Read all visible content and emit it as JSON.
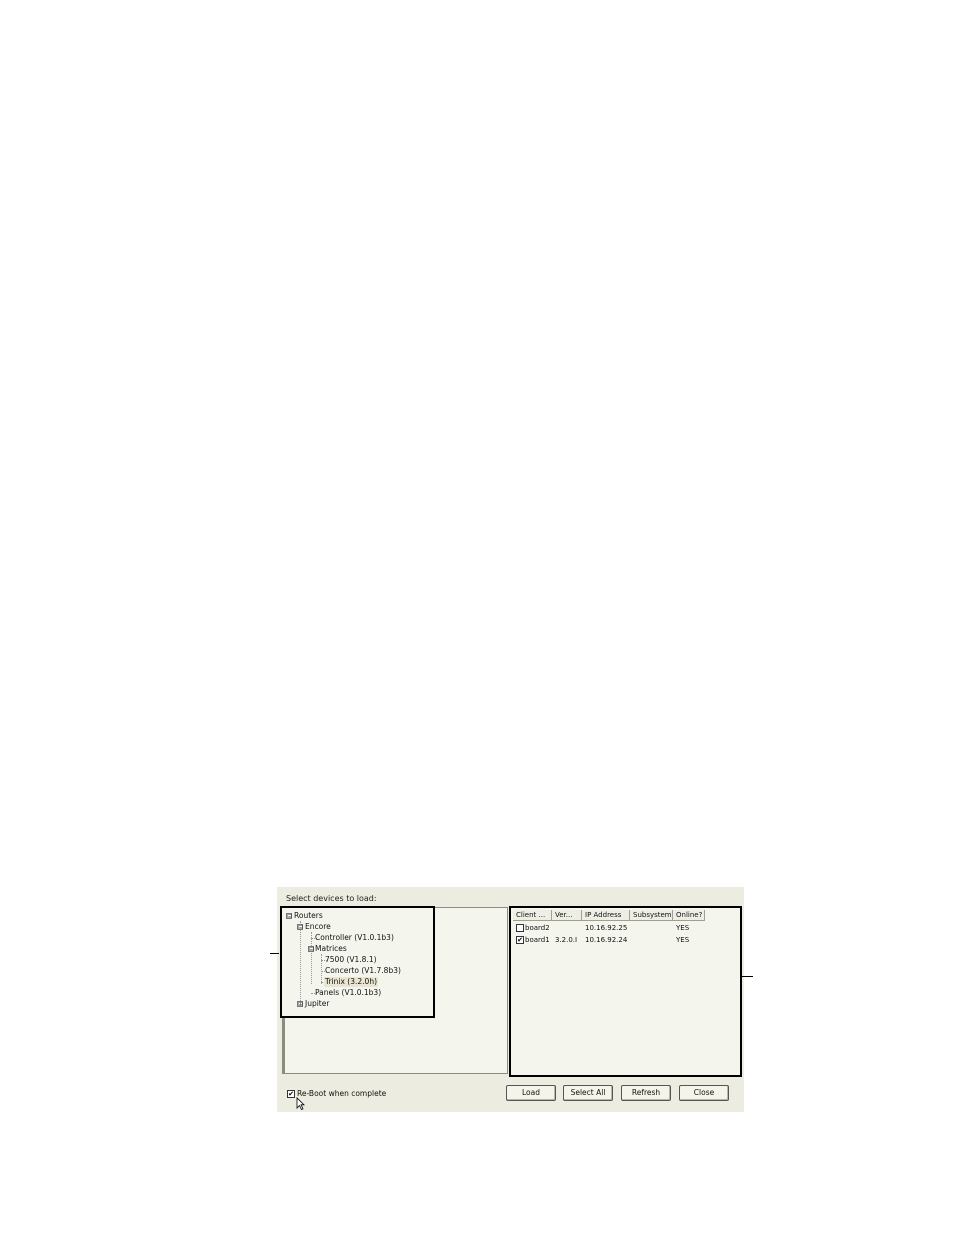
{
  "dialog": {
    "caption": "Select devices to load:",
    "tree": {
      "root": "Routers",
      "encore": "Encore",
      "controller": "Controller (V1.0.1b3)",
      "matrices": "Matrices",
      "m7500": "7500 (V1.8.1)",
      "concerto": "Concerto (V1.7.8b3)",
      "trinix": "Trinix (3.2.0h)",
      "panels": "Panels (V1.0.1b3)",
      "jupiter": "Jupiter",
      "expand_minus": "⊟",
      "expand_plus": "⊞"
    },
    "table": {
      "columns": [
        "Client ...",
        "Ver...",
        "IP Address",
        "Subsystem",
        "Online?"
      ],
      "rows": [
        {
          "checked": false,
          "client": "board2",
          "version": "",
          "ip": "10.16.92.25",
          "subsystem": "",
          "online": "YES"
        },
        {
          "checked": true,
          "client": "board1",
          "version": "3.2.0.I",
          "ip": "10.16.92.24",
          "subsystem": "",
          "online": "YES"
        }
      ]
    },
    "reboot": {
      "checked": true,
      "label": "Re-Boot when complete"
    },
    "buttons": {
      "load": "Load",
      "select_all": "Select All",
      "refresh": "Refresh",
      "close": "Close"
    },
    "icons": {
      "checkmark": "✔",
      "cursor": "arrow-cursor-icon"
    }
  }
}
